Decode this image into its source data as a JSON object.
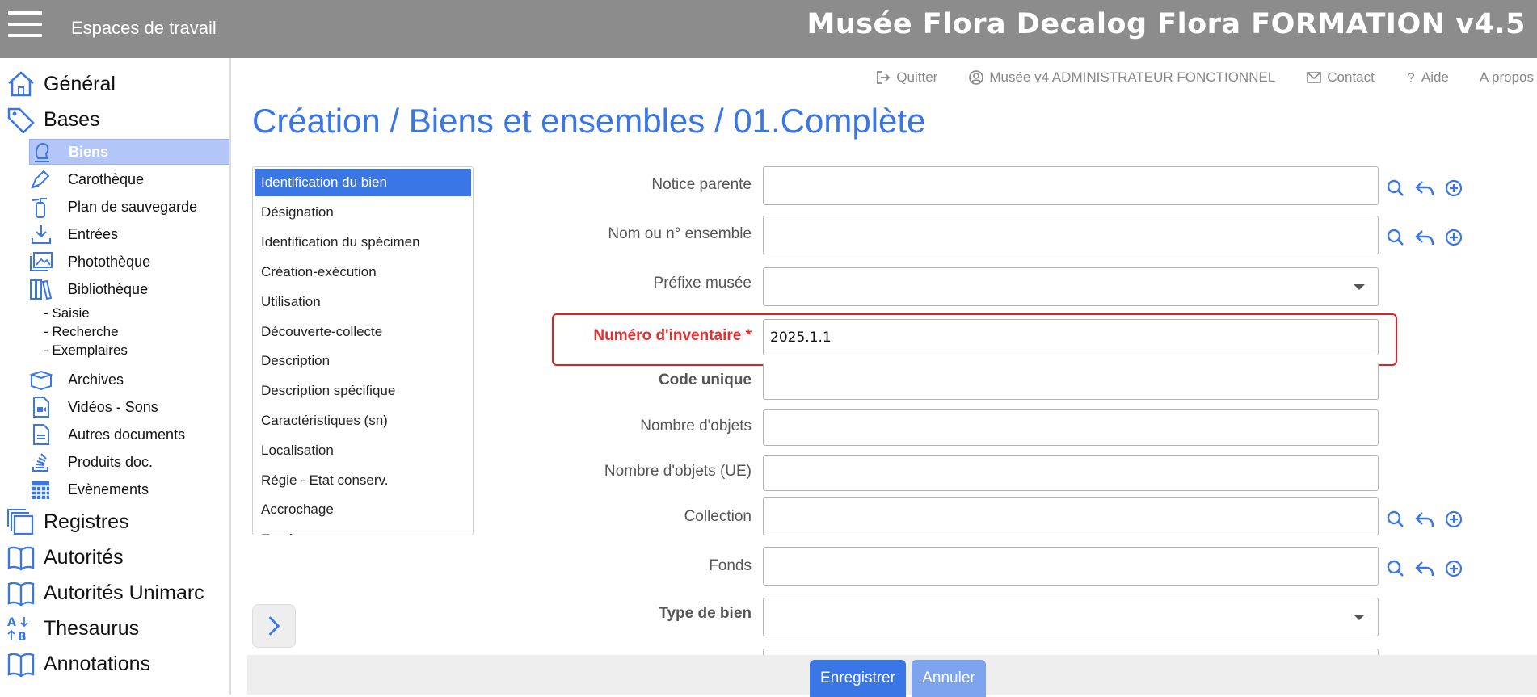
{
  "header": {
    "workspaces_label": "Espaces de travail",
    "app_title": "Musée Flora Decalog Flora FORMATION v4.5"
  },
  "sidebar": {
    "general": "Général",
    "bases": "Bases",
    "bases_items": [
      {
        "label": "Biens",
        "icon": "bust-icon"
      },
      {
        "label": "Carothèque",
        "icon": "pen-icon"
      },
      {
        "label": "Plan de sauvegarde",
        "icon": "extinguisher-icon"
      },
      {
        "label": "Entrées",
        "icon": "download-icon"
      },
      {
        "label": "Photothèque",
        "icon": "images-icon"
      },
      {
        "label": "Bibliothèque",
        "icon": "books-icon"
      }
    ],
    "library_sub": [
      "- Saisie",
      "- Recherche",
      "- Exemplaires"
    ],
    "other_items": [
      {
        "label": "Archives",
        "icon": "box-icon"
      },
      {
        "label": "Vidéos - Sons",
        "icon": "video-file-icon"
      },
      {
        "label": "Autres documents",
        "icon": "document-icon"
      },
      {
        "label": "Produits doc.",
        "icon": "stack-icon"
      },
      {
        "label": "Evènements",
        "icon": "calendar-icon"
      }
    ],
    "registres": "Registres",
    "autorites": "Autorités",
    "autorites_unimarc": "Autorités Unimarc",
    "thesaurus": "Thesaurus",
    "annotations": "Annotations"
  },
  "topnav": {
    "quit": "Quitter",
    "user": "Musée v4 ADMINISTRATEUR FONCTIONNEL",
    "contact": "Contact",
    "help": "Aide",
    "about": "A propos"
  },
  "page": {
    "title": "Création / Biens et ensembles / 01.Complète"
  },
  "sections": [
    "Identification du bien",
    "Désignation",
    "Identification du spécimen",
    "Création-exécution",
    "Utilisation",
    "Découverte-collecte",
    "Description",
    "Description spécifique",
    "Caractéristiques (sn)",
    "Localisation",
    "Régie - Etat conserv.",
    "Accrochage",
    "Entrée"
  ],
  "form": {
    "notice_parente": {
      "label": "Notice parente",
      "value": ""
    },
    "nom_ensemble": {
      "label": "Nom ou n° ensemble",
      "value": ""
    },
    "prefixe_musee": {
      "label": "Préfixe musée",
      "value": ""
    },
    "numero_inventaire": {
      "label": "Numéro d'inventaire *",
      "value": "2025.1.1"
    },
    "code_unique": {
      "label": "Code unique",
      "value": ""
    },
    "nombre_objets": {
      "label": "Nombre d'objets",
      "value": ""
    },
    "nombre_objets_ue": {
      "label": "Nombre d'objets (UE)",
      "value": ""
    },
    "collection": {
      "label": "Collection",
      "value": ""
    },
    "fonds": {
      "label": "Fonds",
      "value": ""
    },
    "type_bien": {
      "label": "Type de bien",
      "value": ""
    }
  },
  "actions": {
    "save": "Enregistrer",
    "cancel": "Annuler"
  },
  "colors": {
    "accent": "#3b76e6",
    "required": "#e03030",
    "topbar": "#8c8c8c",
    "active_item": "#b4c6f7"
  }
}
